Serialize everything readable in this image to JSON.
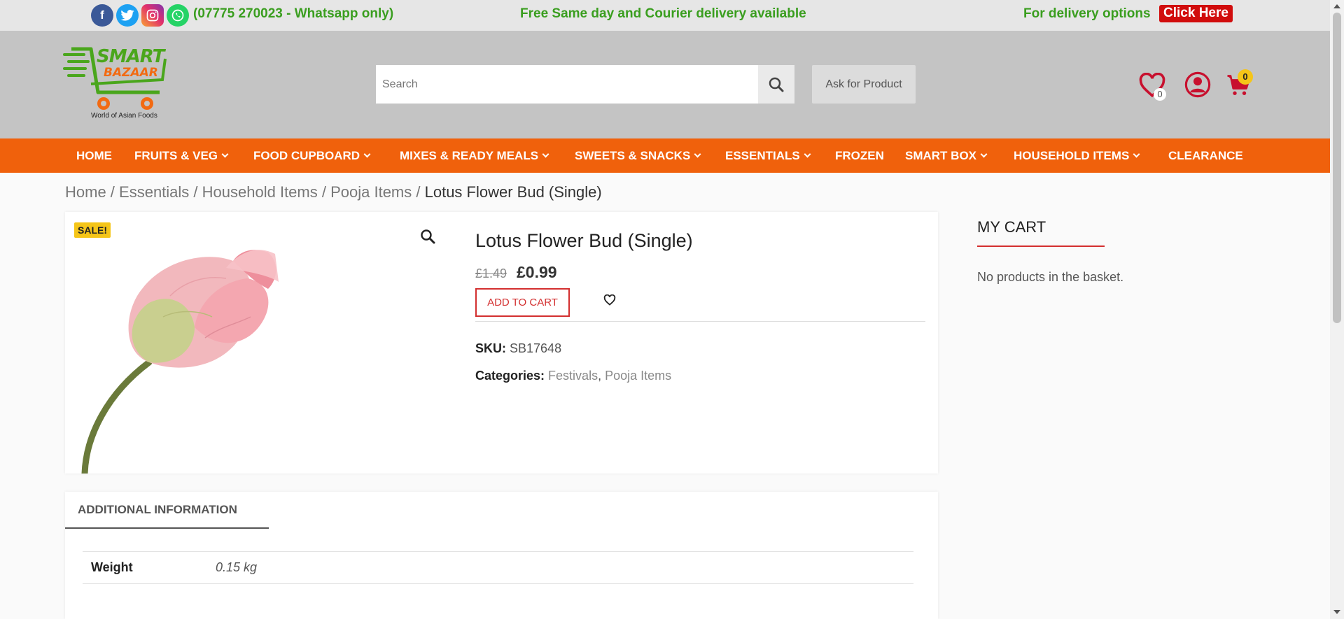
{
  "topbar": {
    "social": [
      "f",
      "t",
      "ig",
      "wa"
    ],
    "phone": "(07775 270023 - Whatsapp only)",
    "free_delivery": "Free Same day and Courier delivery available",
    "delivery_options": "For delivery options",
    "click_here": "Click Here"
  },
  "header": {
    "logo_line1": "SMART",
    "logo_line2": "BAZAAR",
    "logo_tagline": "World of Asian Foods",
    "search_placeholder": "Search",
    "ask_button": "Ask for Product",
    "wishlist_count": "0",
    "cart_count": "0"
  },
  "nav": [
    "HOME",
    "FRUITS & VEG",
    "FOOD CUPBOARD",
    "MIXES & READY MEALS",
    "SWEETS & SNACKS",
    "ESSENTIALS",
    "FROZEN",
    "SMART BOX",
    "HOUSEHOLD ITEMS",
    "CLEARANCE"
  ],
  "breadcrumb": {
    "items": [
      "Home",
      "Essentials",
      "Household Items",
      "Pooja Items"
    ],
    "separator": " / ",
    "current": "Lotus Flower Bud (Single)"
  },
  "product": {
    "sale_badge": "SALE!",
    "title": "Lotus Flower Bud (Single)",
    "old_price": "£1.49",
    "price": "£0.99",
    "add_to_cart": "ADD TO CART",
    "sku_label": "SKU:",
    "sku": "SB17648",
    "categories_label": "Categories:",
    "categories": [
      "Festivals",
      "Pooja Items"
    ],
    "category_separator": ","
  },
  "sidebar": {
    "title": "MY CART",
    "empty_text": "No products in the basket."
  },
  "tabs": {
    "additional_info": "ADDITIONAL INFORMATION",
    "weight_label": "Weight",
    "weight_value": "0.15 kg"
  },
  "colors": {
    "nav_orange": "#f0610c",
    "brand_green": "#3a9e1f",
    "accent_red": "#d32f2f",
    "sale_yellow": "#f5c518"
  }
}
